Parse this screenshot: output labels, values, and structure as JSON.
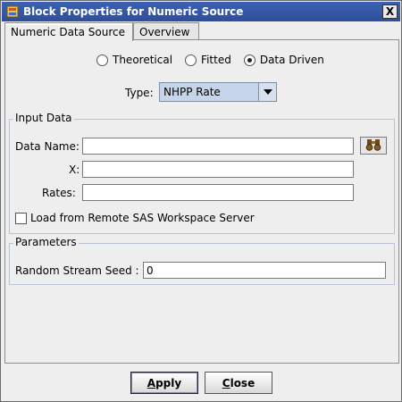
{
  "window": {
    "title": "Block Properties for Numeric Source",
    "close_glyph": "X"
  },
  "tabs": [
    {
      "label": "Numeric Data Source",
      "active": true
    },
    {
      "label": "Overview",
      "active": false
    }
  ],
  "source_type": {
    "options": [
      {
        "label": "Theoretical",
        "checked": false
      },
      {
        "label": "Fitted",
        "checked": false
      },
      {
        "label": "Data Driven",
        "checked": true
      }
    ]
  },
  "type_field": {
    "label": "Type:",
    "value": "NHPP Rate"
  },
  "input_data": {
    "title": "Input Data",
    "data_name": {
      "label": "Data Name:",
      "value": ""
    },
    "x": {
      "label": "X:",
      "value": ""
    },
    "rates": {
      "label": "Rates:",
      "value": ""
    },
    "browse_icon": "binoculars-icon",
    "load_remote": {
      "label": "Load from Remote SAS Workspace Server",
      "checked": false
    }
  },
  "parameters": {
    "title": "Parameters",
    "seed": {
      "label": "Random Stream Seed :",
      "value": "0"
    }
  },
  "buttons": {
    "apply_first": "A",
    "apply_rest": "pply",
    "close_first": "C",
    "close_rest": "lose"
  }
}
